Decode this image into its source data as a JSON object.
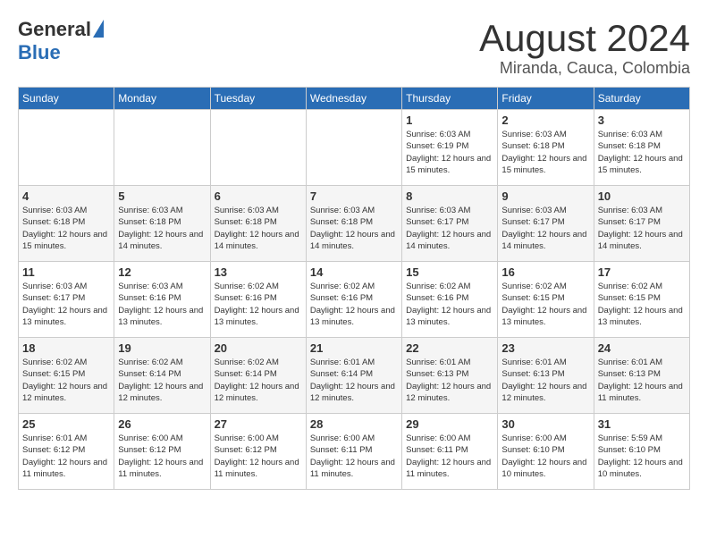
{
  "header": {
    "logo_general": "General",
    "logo_blue": "Blue",
    "month_year": "August 2024",
    "location": "Miranda, Cauca, Colombia"
  },
  "calendar": {
    "days_of_week": [
      "Sunday",
      "Monday",
      "Tuesday",
      "Wednesday",
      "Thursday",
      "Friday",
      "Saturday"
    ],
    "weeks": [
      [
        {
          "day": "",
          "info": ""
        },
        {
          "day": "",
          "info": ""
        },
        {
          "day": "",
          "info": ""
        },
        {
          "day": "",
          "info": ""
        },
        {
          "day": "1",
          "info": "Sunrise: 6:03 AM\nSunset: 6:19 PM\nDaylight: 12 hours and 15 minutes."
        },
        {
          "day": "2",
          "info": "Sunrise: 6:03 AM\nSunset: 6:18 PM\nDaylight: 12 hours and 15 minutes."
        },
        {
          "day": "3",
          "info": "Sunrise: 6:03 AM\nSunset: 6:18 PM\nDaylight: 12 hours and 15 minutes."
        }
      ],
      [
        {
          "day": "4",
          "info": "Sunrise: 6:03 AM\nSunset: 6:18 PM\nDaylight: 12 hours and 15 minutes."
        },
        {
          "day": "5",
          "info": "Sunrise: 6:03 AM\nSunset: 6:18 PM\nDaylight: 12 hours and 14 minutes."
        },
        {
          "day": "6",
          "info": "Sunrise: 6:03 AM\nSunset: 6:18 PM\nDaylight: 12 hours and 14 minutes."
        },
        {
          "day": "7",
          "info": "Sunrise: 6:03 AM\nSunset: 6:18 PM\nDaylight: 12 hours and 14 minutes."
        },
        {
          "day": "8",
          "info": "Sunrise: 6:03 AM\nSunset: 6:17 PM\nDaylight: 12 hours and 14 minutes."
        },
        {
          "day": "9",
          "info": "Sunrise: 6:03 AM\nSunset: 6:17 PM\nDaylight: 12 hours and 14 minutes."
        },
        {
          "day": "10",
          "info": "Sunrise: 6:03 AM\nSunset: 6:17 PM\nDaylight: 12 hours and 14 minutes."
        }
      ],
      [
        {
          "day": "11",
          "info": "Sunrise: 6:03 AM\nSunset: 6:17 PM\nDaylight: 12 hours and 13 minutes."
        },
        {
          "day": "12",
          "info": "Sunrise: 6:03 AM\nSunset: 6:16 PM\nDaylight: 12 hours and 13 minutes."
        },
        {
          "day": "13",
          "info": "Sunrise: 6:02 AM\nSunset: 6:16 PM\nDaylight: 12 hours and 13 minutes."
        },
        {
          "day": "14",
          "info": "Sunrise: 6:02 AM\nSunset: 6:16 PM\nDaylight: 12 hours and 13 minutes."
        },
        {
          "day": "15",
          "info": "Sunrise: 6:02 AM\nSunset: 6:16 PM\nDaylight: 12 hours and 13 minutes."
        },
        {
          "day": "16",
          "info": "Sunrise: 6:02 AM\nSunset: 6:15 PM\nDaylight: 12 hours and 13 minutes."
        },
        {
          "day": "17",
          "info": "Sunrise: 6:02 AM\nSunset: 6:15 PM\nDaylight: 12 hours and 13 minutes."
        }
      ],
      [
        {
          "day": "18",
          "info": "Sunrise: 6:02 AM\nSunset: 6:15 PM\nDaylight: 12 hours and 12 minutes."
        },
        {
          "day": "19",
          "info": "Sunrise: 6:02 AM\nSunset: 6:14 PM\nDaylight: 12 hours and 12 minutes."
        },
        {
          "day": "20",
          "info": "Sunrise: 6:02 AM\nSunset: 6:14 PM\nDaylight: 12 hours and 12 minutes."
        },
        {
          "day": "21",
          "info": "Sunrise: 6:01 AM\nSunset: 6:14 PM\nDaylight: 12 hours and 12 minutes."
        },
        {
          "day": "22",
          "info": "Sunrise: 6:01 AM\nSunset: 6:13 PM\nDaylight: 12 hours and 12 minutes."
        },
        {
          "day": "23",
          "info": "Sunrise: 6:01 AM\nSunset: 6:13 PM\nDaylight: 12 hours and 12 minutes."
        },
        {
          "day": "24",
          "info": "Sunrise: 6:01 AM\nSunset: 6:13 PM\nDaylight: 12 hours and 11 minutes."
        }
      ],
      [
        {
          "day": "25",
          "info": "Sunrise: 6:01 AM\nSunset: 6:12 PM\nDaylight: 12 hours and 11 minutes."
        },
        {
          "day": "26",
          "info": "Sunrise: 6:00 AM\nSunset: 6:12 PM\nDaylight: 12 hours and 11 minutes."
        },
        {
          "day": "27",
          "info": "Sunrise: 6:00 AM\nSunset: 6:12 PM\nDaylight: 12 hours and 11 minutes."
        },
        {
          "day": "28",
          "info": "Sunrise: 6:00 AM\nSunset: 6:11 PM\nDaylight: 12 hours and 11 minutes."
        },
        {
          "day": "29",
          "info": "Sunrise: 6:00 AM\nSunset: 6:11 PM\nDaylight: 12 hours and 11 minutes."
        },
        {
          "day": "30",
          "info": "Sunrise: 6:00 AM\nSunset: 6:10 PM\nDaylight: 12 hours and 10 minutes."
        },
        {
          "day": "31",
          "info": "Sunrise: 5:59 AM\nSunset: 6:10 PM\nDaylight: 12 hours and 10 minutes."
        }
      ]
    ]
  }
}
